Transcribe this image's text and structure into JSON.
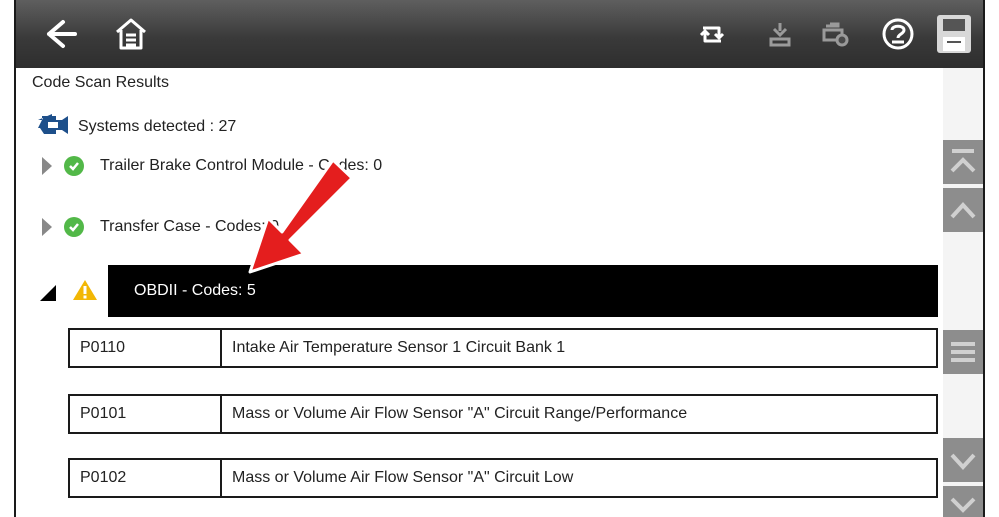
{
  "toolbar": {
    "buttons": [
      {
        "name": "back-arrow-icon"
      },
      {
        "name": "home-icon"
      },
      {
        "name": "clear-codes-icon"
      },
      {
        "name": "vehicle-icon"
      },
      {
        "name": "engine-search-icon"
      },
      {
        "name": "help-icon"
      },
      {
        "name": "save-icon"
      }
    ]
  },
  "page": {
    "title": "Code Scan Results",
    "systems_label": "Systems detected : 27"
  },
  "systems": [
    {
      "label": "Trailer Brake Control Module - Codes: 0",
      "status": "ok"
    },
    {
      "label": "Transfer Case - Codes: 0",
      "status": "ok"
    },
    {
      "label": "OBDII - Codes: 5",
      "status": "warning",
      "expanded": true
    }
  ],
  "codes": [
    {
      "code": "P0110",
      "description": "Intake Air Temperature Sensor 1 Circuit Bank 1"
    },
    {
      "code": "P0101",
      "description": "Mass or Volume Air Flow Sensor \"A\" Circuit Range/Performance"
    },
    {
      "code": "P0102",
      "description": "Mass or Volume Air Flow Sensor \"A\" Circuit Low"
    }
  ],
  "colors": {
    "toolbar": "#3a3a3a",
    "ok": "#52b848",
    "warning": "#f2b705",
    "selected": "#000000",
    "callout_arrow": "#e41e1e",
    "scroll_buttons": "#8d8d8d"
  }
}
